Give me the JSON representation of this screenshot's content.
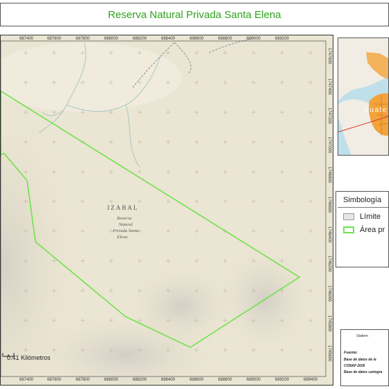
{
  "title": "Reserva Natural Privada Santa Elena",
  "map": {
    "region_label": "IZABAL",
    "feature_label": [
      "Reserva",
      "Natural",
      "Privada Santa",
      "Elena"
    ],
    "x_ticks": [
      "687400",
      "687600",
      "687800",
      "688000",
      "688200",
      "688400",
      "688600",
      "688800",
      "689000",
      "689200"
    ],
    "x_ticks_bottom": [
      "687400",
      "687600",
      "687800",
      "688000",
      "688200",
      "688400",
      "688600",
      "688800",
      "689000",
      "689200",
      "689400"
    ],
    "y_ticks": [
      "1747600",
      "1747400",
      "1747200",
      "1747000",
      "1746800",
      "1746600",
      "1746400",
      "1746200",
      "1746000",
      "1745800",
      "1745600"
    ],
    "scale_label": "0.41 Kilómetros",
    "colors": {
      "boundary": "#6ee34a",
      "terrain": "#e9e2cf",
      "river": "#a9c7c2"
    }
  },
  "inset": {
    "label": "Guate",
    "colors": {
      "sea": "#bfe0ea",
      "land": "#f4a23a",
      "pointer": "#d8322b"
    }
  },
  "legend": {
    "title": "Simbología",
    "items": [
      {
        "label": "Límite",
        "swatch_fill": "#e6e6e6",
        "swatch_border": "#9a9a9a"
      },
      {
        "label": "Área pr",
        "swatch_fill": "#ffffff",
        "swatch_border": "#6ee34a"
      }
    ]
  },
  "info": {
    "system": "Sistem",
    "source_label": "Fuente:",
    "lines": [
      "Base de datos de la",
      "CONAP 2026",
      "Base de datos cartogra"
    ]
  }
}
